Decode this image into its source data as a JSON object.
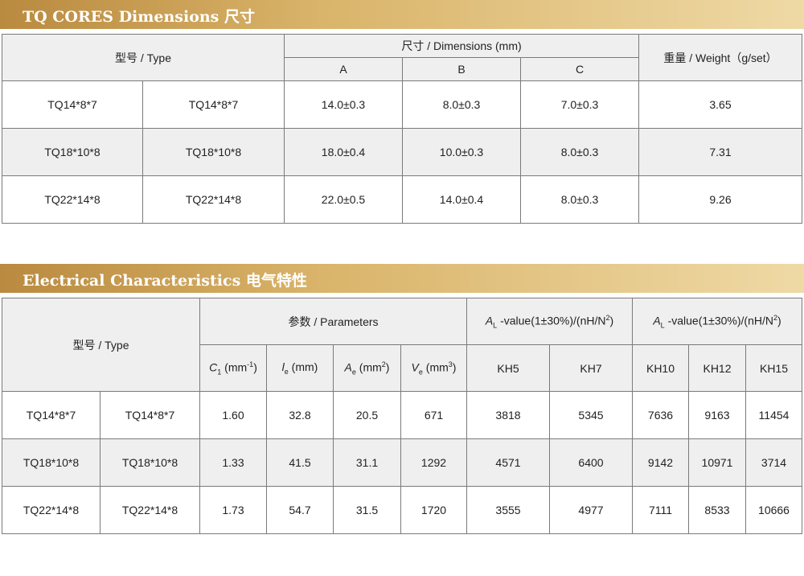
{
  "dimensions": {
    "banner_title": "TQ CORES Dimensions 尺寸",
    "headers": {
      "type": "型号 / Type",
      "dimensions": "尺寸 / Dimensions (mm)",
      "a": "A",
      "b": "B",
      "c": "C",
      "weight": "重量 / Weight（g/set）"
    },
    "rows": [
      [
        "TQ14*8*7",
        "TQ14*8*7",
        "14.0±0.3",
        "8.0±0.3",
        "7.0±0.3",
        "3.65"
      ],
      [
        "TQ18*10*8",
        "TQ18*10*8",
        "18.0±0.4",
        "10.0±0.3",
        "8.0±0.3",
        "7.31"
      ],
      [
        "TQ22*14*8",
        "TQ22*14*8",
        "22.0±0.5",
        "14.0±0.4",
        "8.0±0.3",
        "9.26"
      ]
    ]
  },
  "electrical": {
    "banner_title": "Electrical Characteristics 电气特性",
    "headers": {
      "type": "型号 / Type",
      "parameters": "参数 / Parameters",
      "al_group_1": {
        "A": "A",
        "L": "L",
        "text": " -value(1±30%)/(nH/N",
        "exp": "2",
        "close": ")"
      },
      "al_group_2": {
        "A": "A",
        "L": "L",
        "text": " -value(1±30%)/(nH/N",
        "exp": "2",
        "close": ")"
      },
      "c1": {
        "sym": "C",
        "sub": "1",
        "unit": " (mm",
        "exp": "-1",
        "close": ")"
      },
      "le": {
        "sym": "l",
        "sub": "e",
        "unit": " (mm)"
      },
      "ae": {
        "sym": "A",
        "sub": "e",
        "unit": " (mm",
        "exp": "2",
        "close": ")"
      },
      "ve": {
        "sym": "V",
        "sub": "e",
        "unit": " (mm",
        "exp": "3",
        "close": ")"
      },
      "materials": [
        "KH5",
        "KH7",
        "KH10",
        "KH12",
        "KH15"
      ]
    },
    "rows": [
      [
        "TQ14*8*7",
        "TQ14*8*7",
        "1.60",
        "32.8",
        "20.5",
        "671",
        "3818",
        "5345",
        "7636",
        "9163",
        "11454"
      ],
      [
        "TQ18*10*8",
        "TQ18*10*8",
        "1.33",
        "41.5",
        "31.1",
        "1292",
        "4571",
        "6400",
        "9142",
        "10971",
        "3714"
      ],
      [
        "TQ22*14*8",
        "TQ22*14*8",
        "1.73",
        "54.7",
        "31.5",
        "1720",
        "3555",
        "4977",
        "7111",
        "8533",
        "10666"
      ]
    ]
  },
  "colors": {
    "banner_start": "#b98a3f",
    "banner_end": "#efd9a5",
    "header_bg": "#efefef",
    "border": "#7a7a7a"
  }
}
